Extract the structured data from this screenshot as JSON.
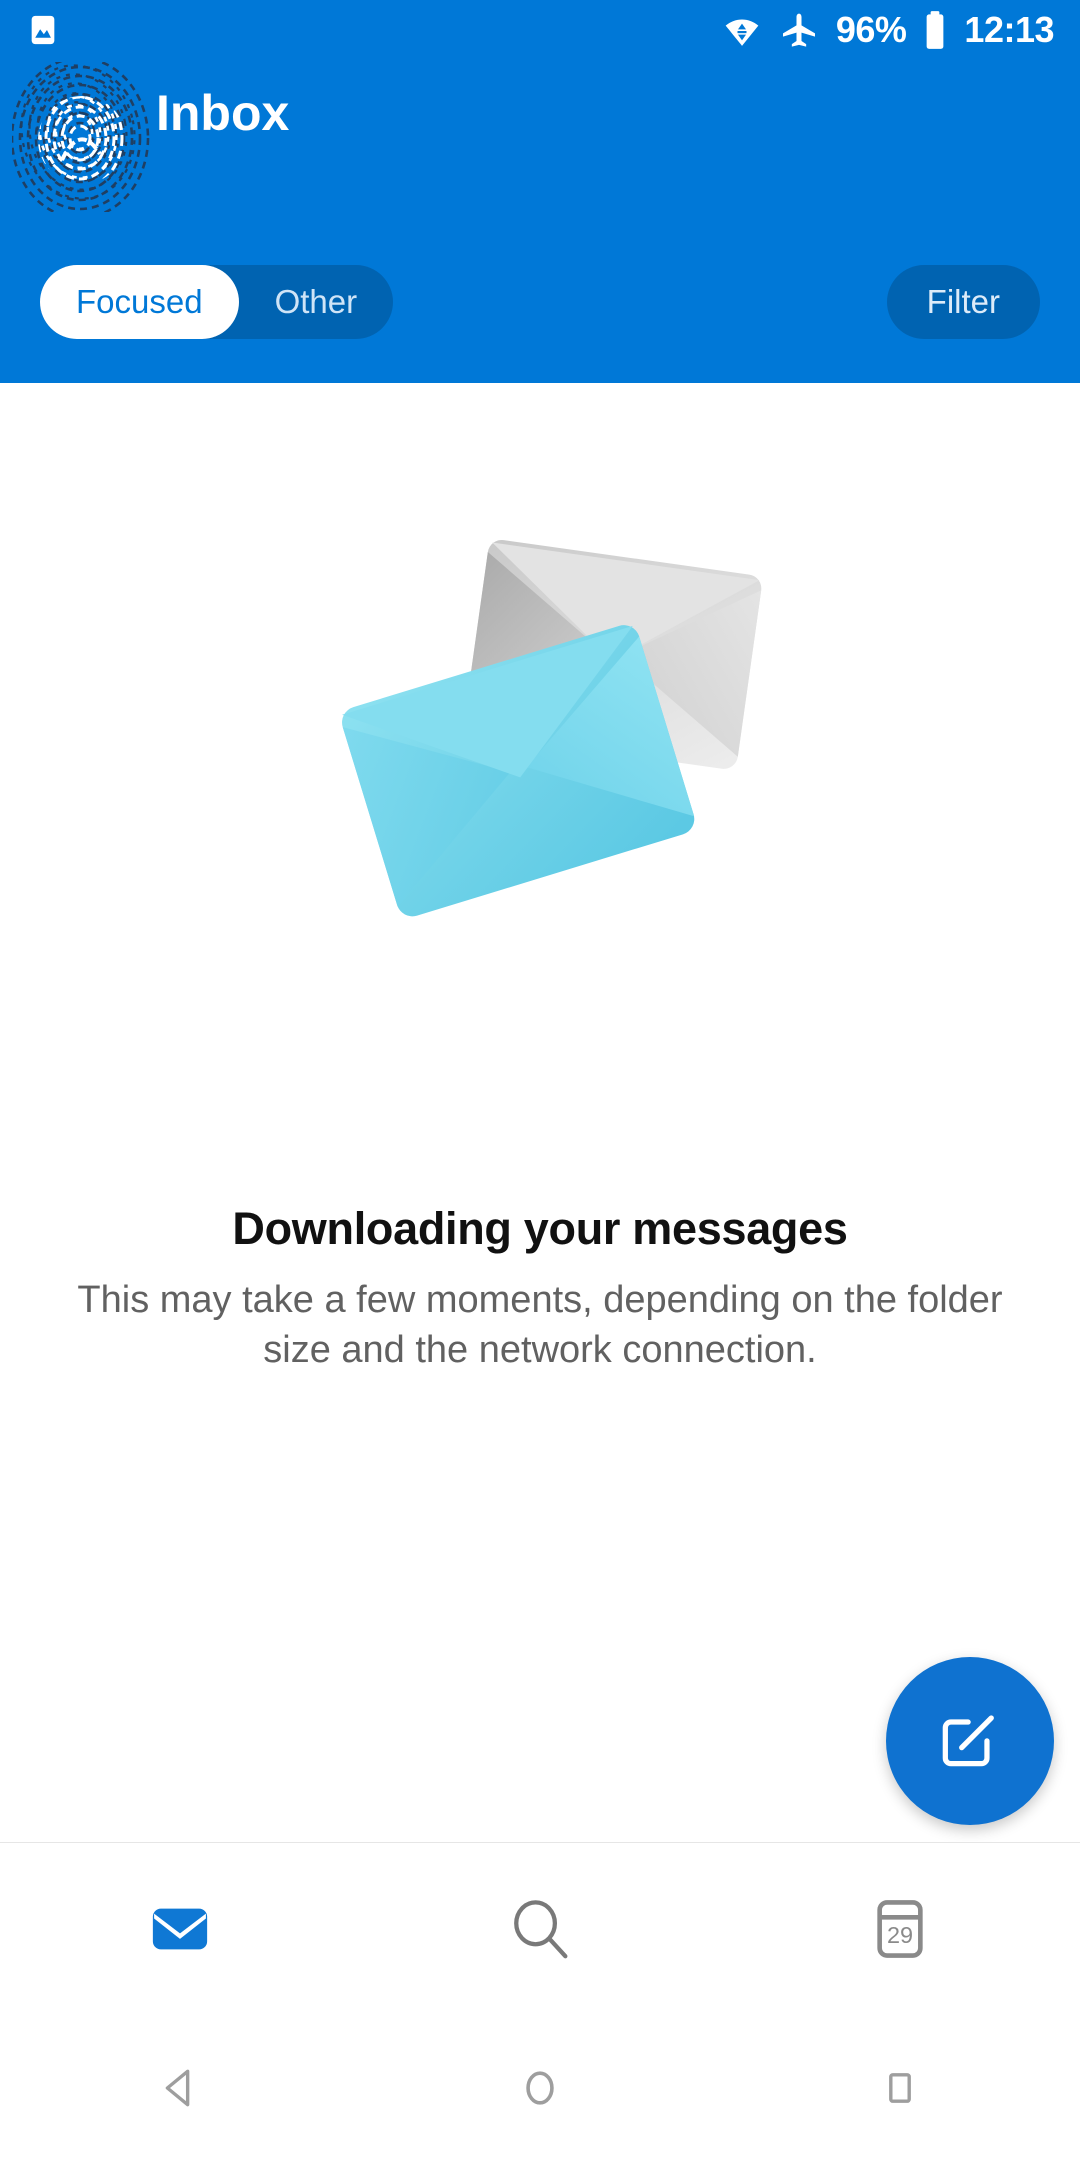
{
  "statusbar": {
    "gallery_icon": "image-icon",
    "wifi_icon": "wifi-data-transfer-icon",
    "airplane_icon": "airplane-mode-icon",
    "battery_percent": "96%",
    "battery_icon": "battery-full-icon",
    "time": "12:13"
  },
  "header": {
    "avatar_name": "fingerprint-avatar",
    "title": "Inbox",
    "accent_color": "#0078D7",
    "pivot_inactive_bg": "#0063B1",
    "tabs": [
      {
        "label": "Focused",
        "active": true
      },
      {
        "label": "Other",
        "active": false
      }
    ],
    "filter_label": "Filter"
  },
  "main": {
    "illustration": "two-envelopes-illustration",
    "envelope_back_color": "#D8D8D8",
    "envelope_front_color": "#6FD3E8",
    "title": "Downloading your messages",
    "subtitle": "This may take a few moments, depending on the folder size and the network connection.",
    "fab": {
      "icon": "compose-icon",
      "color": "#0F72D0"
    }
  },
  "bottomnav": {
    "items": [
      {
        "name": "mail",
        "icon": "mail-icon",
        "active": true,
        "color": "#0F78D4"
      },
      {
        "name": "search",
        "icon": "search-icon",
        "active": false,
        "color": "#797979"
      },
      {
        "name": "calendar",
        "icon": "calendar-icon",
        "active": false,
        "color": "#8A8A8A",
        "day": "29"
      }
    ]
  },
  "androidnav": {
    "items": [
      {
        "name": "back",
        "icon": "back-triangle-icon"
      },
      {
        "name": "home",
        "icon": "home-circle-icon"
      },
      {
        "name": "recents",
        "icon": "recents-square-icon"
      }
    ]
  }
}
